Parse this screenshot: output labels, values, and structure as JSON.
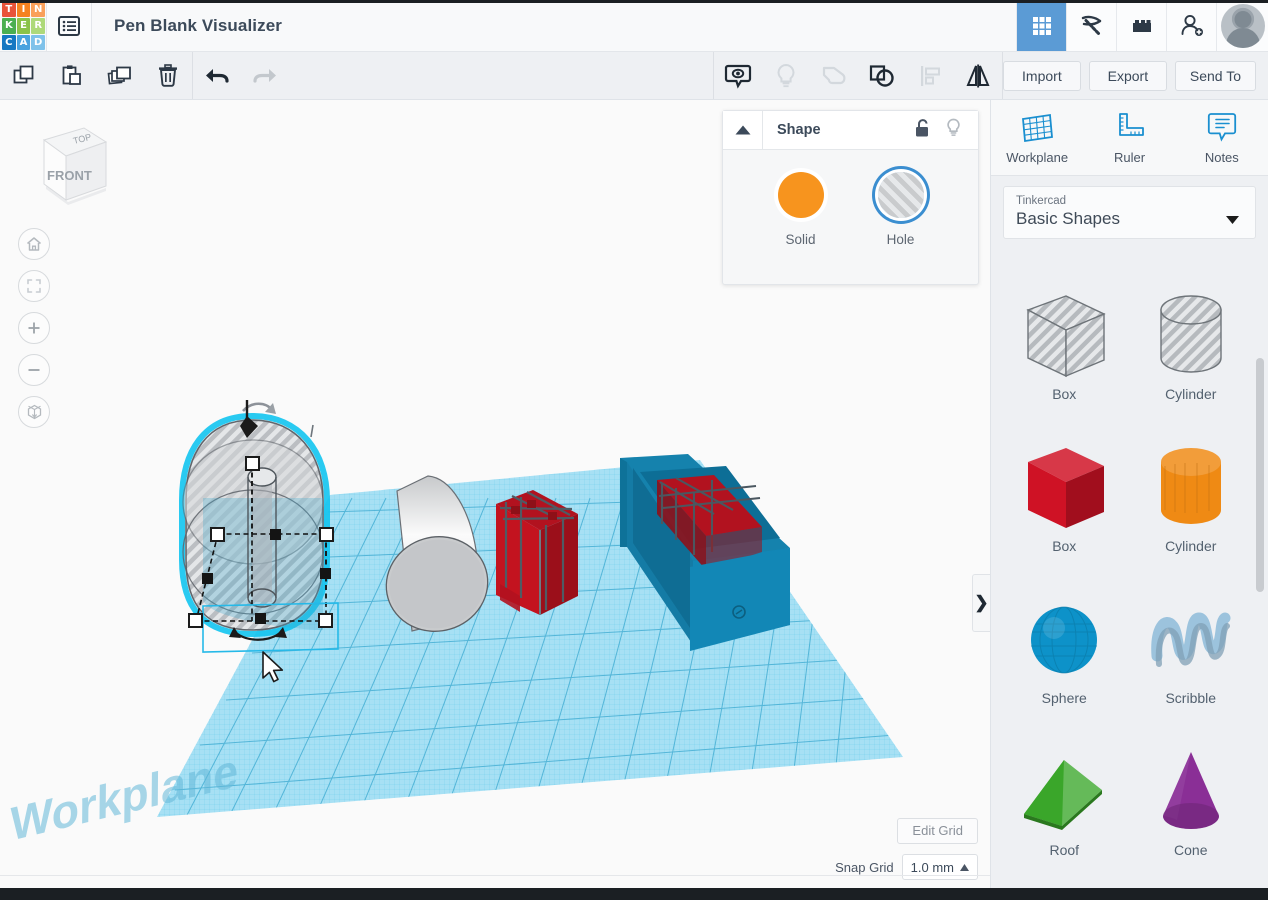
{
  "app": {
    "logo_letters": [
      {
        "ch": "T",
        "color": "#e8533a"
      },
      {
        "ch": "I",
        "color": "#f58220"
      },
      {
        "ch": "N",
        "color": "#f9a05a"
      },
      {
        "ch": "K",
        "color": "#4caf50"
      },
      {
        "ch": "E",
        "color": "#8bc34a"
      },
      {
        "ch": "R",
        "color": "#aed97a"
      },
      {
        "ch": "C",
        "color": "#1678c2"
      },
      {
        "ch": "A",
        "color": "#4aa3df"
      },
      {
        "ch": "D",
        "color": "#7fc2ea"
      }
    ],
    "document_title": "Pen Blank Visualizer",
    "menu_icon": "list-menu-icon",
    "top_icons": [
      {
        "name": "gallery-grid-icon",
        "active": true
      },
      {
        "name": "pickaxe-icon",
        "active": false
      },
      {
        "name": "brick-blocks-icon",
        "active": false
      },
      {
        "name": "add-person-icon",
        "active": false
      }
    ],
    "avatar_name": "user-avatar"
  },
  "toolbar": {
    "left_icons": [
      {
        "name": "copy-icon",
        "enabled": true
      },
      {
        "name": "paste-icon",
        "enabled": true
      },
      {
        "name": "duplicate-icon",
        "enabled": true
      },
      {
        "name": "delete-trash-icon",
        "enabled": true
      }
    ],
    "history_icons": [
      {
        "name": "undo-icon",
        "enabled": true
      },
      {
        "name": "redo-icon",
        "enabled": false
      }
    ],
    "center_icons": [
      {
        "name": "view-inspect-icon",
        "enabled": true
      },
      {
        "name": "lightbulb-icon",
        "enabled": false
      },
      {
        "name": "shape-outline-icon",
        "enabled": false
      },
      {
        "name": "group-shapes-icon",
        "enabled": true
      },
      {
        "name": "align-icon",
        "enabled": false
      },
      {
        "name": "mirror-flip-icon",
        "enabled": true
      }
    ],
    "actions": [
      {
        "label": "Import",
        "name": "import-button"
      },
      {
        "label": "Export",
        "name": "export-button"
      },
      {
        "label": "Send To",
        "name": "send-to-button"
      }
    ]
  },
  "canvas": {
    "viewcube": {
      "top_label": "TOP",
      "front_label": "FRONT"
    },
    "nav_buttons": [
      {
        "name": "home-view-button",
        "icon": "home-icon"
      },
      {
        "name": "fit-to-view-button",
        "icon": "fit-frame-icon"
      },
      {
        "name": "zoom-in-button",
        "icon": "plus-icon"
      },
      {
        "name": "zoom-out-button",
        "icon": "minus-icon"
      },
      {
        "name": "perspective-toggle-button",
        "icon": "cube-perspective-icon"
      }
    ],
    "workplane_label": "Workplane",
    "edit_grid_label": "Edit Grid",
    "snap_grid_label": "Snap Grid",
    "snap_grid_value": "1.0 mm",
    "panel_tab_glyph": "❯",
    "cursor_name": "mouse-pointer"
  },
  "shape_panel": {
    "title": "Shape",
    "collapse_icon": "chevron-up-icon",
    "lock_icon": "unlock-icon",
    "light_icon": "lightbulb-icon",
    "options": [
      {
        "label": "Solid",
        "name": "solid-swatch",
        "selected": false
      },
      {
        "label": "Hole",
        "name": "hole-swatch",
        "selected": true
      }
    ]
  },
  "right_panel": {
    "tools": [
      {
        "label": "Workplane",
        "icon": "workplane-grid-icon"
      },
      {
        "label": "Ruler",
        "icon": "ruler-icon"
      },
      {
        "label": "Notes",
        "icon": "notes-icon"
      }
    ],
    "library": {
      "group_label": "Tinkercad",
      "selected": "Basic Shapes",
      "caret_icon": "chevron-down-icon"
    },
    "shapes": [
      {
        "label": "Box",
        "name": "shape-box-hole",
        "kind": "box",
        "style": "hole",
        "color": "#c3c6c9"
      },
      {
        "label": "Cylinder",
        "name": "shape-cylinder-hole",
        "kind": "cylinder",
        "style": "hole",
        "color": "#c3c6c9"
      },
      {
        "label": "Box",
        "name": "shape-box-red",
        "kind": "box",
        "style": "solid",
        "color": "#cf1225"
      },
      {
        "label": "Cylinder",
        "name": "shape-cylinder-orange",
        "kind": "cylinder",
        "style": "solid",
        "color": "#ef8a14"
      },
      {
        "label": "Sphere",
        "name": "shape-sphere-blue",
        "kind": "sphere",
        "style": "solid",
        "color": "#0d92c9"
      },
      {
        "label": "Scribble",
        "name": "shape-scribble",
        "kind": "scribble",
        "style": "solid",
        "color": "#9cc3dd"
      },
      {
        "label": "Roof",
        "name": "shape-roof-green",
        "kind": "roof",
        "style": "solid",
        "color": "#3aa62a"
      },
      {
        "label": "Cone",
        "name": "shape-cone-purple",
        "kind": "cone",
        "style": "solid",
        "color": "#8a2f96"
      }
    ]
  },
  "colors": {
    "accent_blue": "#5b9bd5",
    "tool_blue": "#1a8fd0",
    "workplane_blue": "#7fd6f2",
    "selection_cyan": "#00c8f0",
    "solid_orange": "#f7941e",
    "header_bg": "#f8f9fa",
    "toolbar_bg": "#eef0f3"
  }
}
